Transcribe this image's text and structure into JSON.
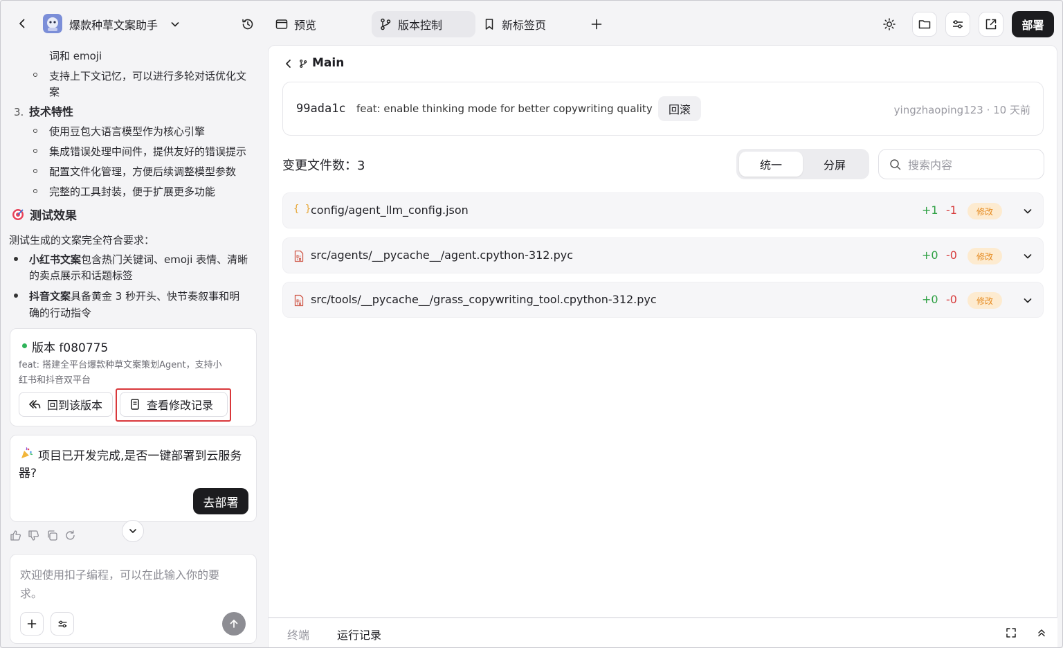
{
  "header": {
    "project_name": "爆款种草文案助手",
    "tabs": [
      {
        "label": "预览"
      },
      {
        "label": "版本控制"
      },
      {
        "label": "新标签页"
      }
    ],
    "deploy_label": "部署"
  },
  "chat": {
    "lines": [
      "词和 emoji",
      "支持上下文记忆，可以进行多轮对话优化文",
      "案",
      "技术特性",
      "使用豆包大语言模型作为核心引擎",
      "集成错误处理中间件，提供友好的错误提示",
      "配置文件化管理，方便后续调整模型参数",
      "完整的工具封装，便于扩展更多功能",
      "测试效果",
      "测试生成的文案完全符合要求：",
      "包含热门关键词、emoji 表情、清晰",
      "的卖点展示和话题标签",
      "具备黄金 3 秒开头、快节奏叙事和明",
      "确的行动指令"
    ],
    "list_number": "3.",
    "bold_xhs": "小红书文案",
    "bold_douyin": "抖音文案",
    "version_card": {
      "title": "版本 f080775",
      "desc_1": "feat: 搭建全平台爆款种草文案策划Agent，支持小",
      "desc_2": "红书和抖音双平台",
      "restore_label": "回到该版本",
      "history_label": "查看修改记录"
    },
    "deploy_card": {
      "text_1": "项目已开发完成,是否一键部署到云服务",
      "text_2": "器?",
      "button_label": "去部署"
    },
    "input_placeholder_1": "欢迎使用扣子编程，可以在此输入你的要",
    "input_placeholder_2": "求。"
  },
  "vcs": {
    "branch": "Main",
    "commit": {
      "hash": "99ada1c",
      "message": "feat: enable thinking mode for better copywriting quality",
      "rollback_label": "回滚",
      "meta": "yingzhaoping123 · 10 天前"
    },
    "changed_files_label": "变更文件数：3",
    "view_modes": [
      {
        "label": "统一"
      },
      {
        "label": "分屏"
      }
    ],
    "search_placeholder": "搜索内容",
    "files": [
      {
        "path": "config/agent_llm_config.json",
        "added": "+1",
        "removed": "-1",
        "status": "修改"
      },
      {
        "path": "src/agents/__pycache__/agent.cpython-312.pyc",
        "added": "+0",
        "removed": "-0",
        "status": "修改"
      },
      {
        "path": "src/tools/__pycache__/grass_copywriting_tool.cpython-312.pyc",
        "added": "+0",
        "removed": "-0",
        "status": "修改"
      }
    ]
  },
  "bottom": {
    "tabs": [
      {
        "label": "终端"
      },
      {
        "label": "运行记录"
      }
    ]
  },
  "colors": {
    "accent_dark": "#1c1c1f",
    "added": "#2ea043",
    "removed": "#d73a3a",
    "badge_bg": "#fdebd0",
    "badge_fg": "#e58a1f",
    "highlight_box": "#d9373a"
  }
}
